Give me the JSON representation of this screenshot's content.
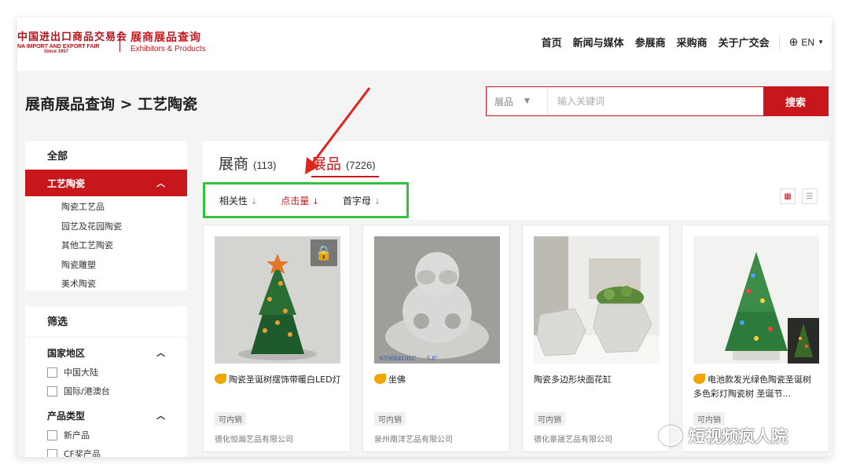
{
  "header": {
    "logo_cn": "中国进出口商品交易会",
    "logo_en": "NA IMPORT AND EXPORT FAIR",
    "logo_since": "Since 1957",
    "section_cn": "展商展品查询",
    "section_en": "Exhibitors & Products",
    "nav": [
      "首页",
      "新闻与媒体",
      "参展商",
      "采购商",
      "关于广交会"
    ],
    "lang": "EN",
    "lang_icon": "globe-icon"
  },
  "page_title": "展商展品查询 > 工艺陶瓷",
  "search": {
    "select_value": "展品",
    "placeholder": "输入关键词",
    "button": "搜索"
  },
  "sidebar": {
    "all_label": "全部",
    "active_category": "工艺陶瓷",
    "subcategories": [
      "陶瓷工艺品",
      "园艺及花园陶瓷",
      "其他工艺陶瓷",
      "陶瓷雕塑",
      "美术陶瓷"
    ],
    "filter_title": "筛选",
    "groups": [
      {
        "title": "国家地区",
        "options": [
          "中国大陆",
          "国际/港澳台"
        ]
      },
      {
        "title": "产品类型",
        "options": [
          "新产品",
          "CF奖产品"
        ]
      }
    ]
  },
  "tabs": {
    "exhibitors_label": "展商",
    "exhibitors_count": "(113)",
    "products_label": "展品",
    "products_count": "(7226)"
  },
  "sorts": [
    {
      "label": "相关性",
      "arrow": "↓",
      "active": false
    },
    {
      "label": "点击量",
      "arrow": "↓",
      "active": true
    },
    {
      "label": "首字母",
      "arrow": "↓",
      "active": false
    }
  ],
  "products": [
    {
      "name": "陶瓷圣诞树摆饰带暖白LED灯",
      "cf": true,
      "badge": "可内销",
      "company": "德化恒瀚艺品有限公司"
    },
    {
      "name": "坐佛",
      "cf": true,
      "badge": "可内销",
      "company": "泉州南洋艺品有限公司",
      "img_caption": "NY9084101C      5.8\""
    },
    {
      "name": "陶瓷多边形块面花缸",
      "cf": false,
      "badge": "可内销",
      "company": "德化豪晟艺品有限公司"
    },
    {
      "name": "电池款发光绿色陶瓷圣诞树 多色彩灯陶瓷树 圣诞节...",
      "cf": true,
      "badge": "可内销",
      "company": ""
    }
  ],
  "watermark": "短视频疯人院",
  "colors": {
    "brand_red": "#c8161d",
    "highlight_green": "#34c33c",
    "arrow_red": "#e0241c"
  }
}
